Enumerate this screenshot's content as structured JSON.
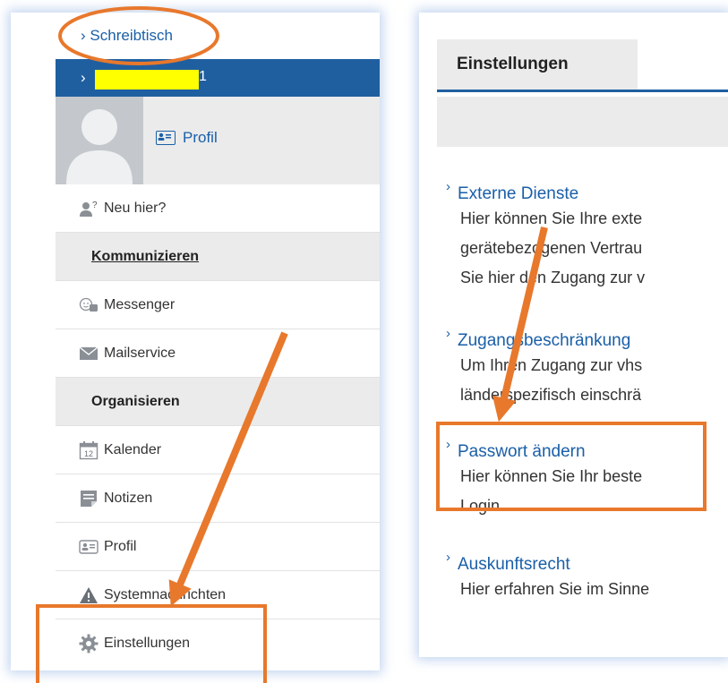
{
  "sidebar": {
    "breadcrumb": "Schreibtisch",
    "user_bar_suffix": "1",
    "profile_link": "Profil",
    "new_here": "Neu hier?",
    "section_communicate": "Kommunizieren",
    "messenger": "Messenger",
    "mailservice": "Mailservice",
    "section_organize": "Organisieren",
    "calendar": "Kalender",
    "calendar_day": "12",
    "notes": "Notizen",
    "profile": "Profil",
    "system_messages": "Systemnachrichten",
    "settings": "Einstellungen"
  },
  "settings_page": {
    "tab": "Einstellungen",
    "entries": [
      {
        "title": "Externe Dienste",
        "lines": [
          "Hier können Sie Ihre exte",
          "gerätebezogenen Vertrau",
          "Sie hier den Zugang zur v"
        ]
      },
      {
        "title": "Zugangsbeschränkung",
        "lines": [
          "Um Ihren Zugang zur vhs",
          "länderspezifisch einschrä"
        ]
      },
      {
        "title": "Passwort ändern",
        "lines": [
          "Hier können Sie Ihr beste",
          "Login."
        ]
      },
      {
        "title": "Auskunftsrecht",
        "lines": [
          "Hier erfahren Sie im Sinne"
        ]
      }
    ]
  },
  "colors": {
    "link_blue": "#1a5fa8",
    "header_blue": "#1f5fa0",
    "annotation_orange": "#e8782c",
    "redaction_yellow": "#ffff00"
  }
}
